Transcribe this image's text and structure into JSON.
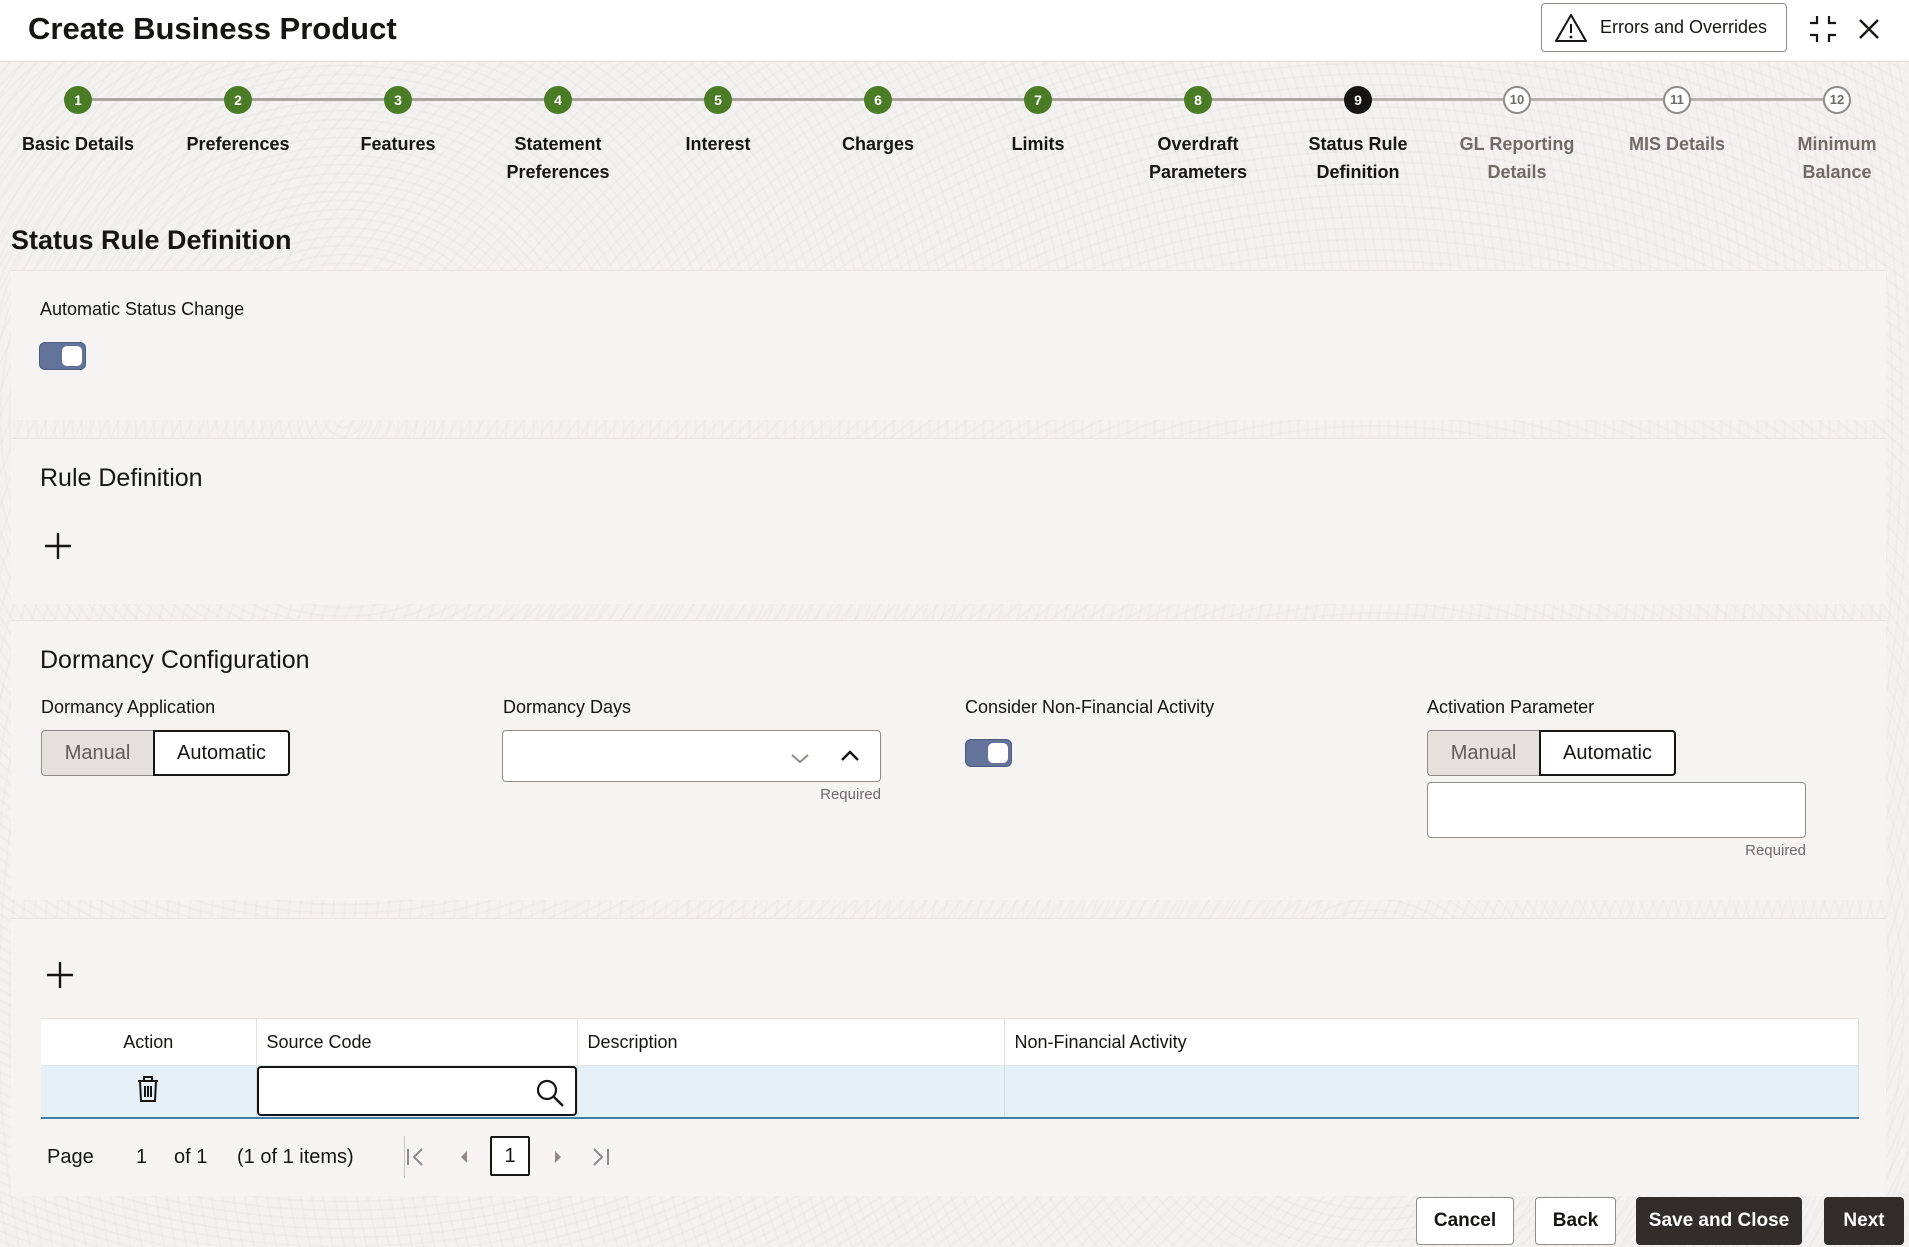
{
  "header": {
    "title": "Create Business Product",
    "errors_button": "Errors and Overrides"
  },
  "stepper": {
    "steps": [
      {
        "num": "1",
        "label": "Basic Details",
        "state": "done"
      },
      {
        "num": "2",
        "label": "Preferences",
        "state": "done"
      },
      {
        "num": "3",
        "label": "Features",
        "state": "done"
      },
      {
        "num": "4",
        "label": "Statement Preferences",
        "state": "done"
      },
      {
        "num": "5",
        "label": "Interest",
        "state": "done"
      },
      {
        "num": "6",
        "label": "Charges",
        "state": "done"
      },
      {
        "num": "7",
        "label": "Limits",
        "state": "done"
      },
      {
        "num": "8",
        "label": "Overdraft Parameters",
        "state": "done"
      },
      {
        "num": "9",
        "label": "Status Rule Definition",
        "state": "current"
      },
      {
        "num": "10",
        "label": "GL Reporting Details",
        "state": "todo"
      },
      {
        "num": "11",
        "label": "MIS Details",
        "state": "todo"
      },
      {
        "num": "12",
        "label": "Minimum Balance",
        "state": "todo"
      }
    ]
  },
  "page_title": "Status Rule Definition",
  "automatic_status": {
    "label": "Automatic Status Change",
    "enabled": true
  },
  "rule_definition": {
    "title": "Rule Definition"
  },
  "dormancy": {
    "title": "Dormancy Configuration",
    "application": {
      "label": "Dormancy Application",
      "options": [
        "Manual",
        "Automatic"
      ],
      "selected": "Automatic"
    },
    "days": {
      "label": "Dormancy Days",
      "value": "",
      "helper": "Required"
    },
    "non_financial": {
      "label": "Consider Non-Financial Activity",
      "enabled": true
    },
    "activation": {
      "label": "Activation Parameter",
      "options": [
        "Manual",
        "Automatic"
      ],
      "selected": "Automatic",
      "value": "",
      "helper": "Required"
    }
  },
  "table": {
    "columns": [
      "Action",
      "Source Code",
      "Description",
      "Non-Financial Activity"
    ],
    "rows": [
      {
        "source_code": "",
        "description": "",
        "non_financial_activity": ""
      }
    ]
  },
  "pager": {
    "page_label": "Page",
    "page_value": "1",
    "of_label": "of 1",
    "items_label": "(1 of 1 items)",
    "current": "1"
  },
  "footer": {
    "cancel": "Cancel",
    "back": "Back",
    "save_close": "Save and Close",
    "next": "Next"
  },
  "colors": {
    "step_done": "#4a7c26",
    "step_current": "#161513",
    "toggle_on": "#64739a",
    "primary_button": "#312d2a",
    "selected_row": "#e7f0f6"
  }
}
